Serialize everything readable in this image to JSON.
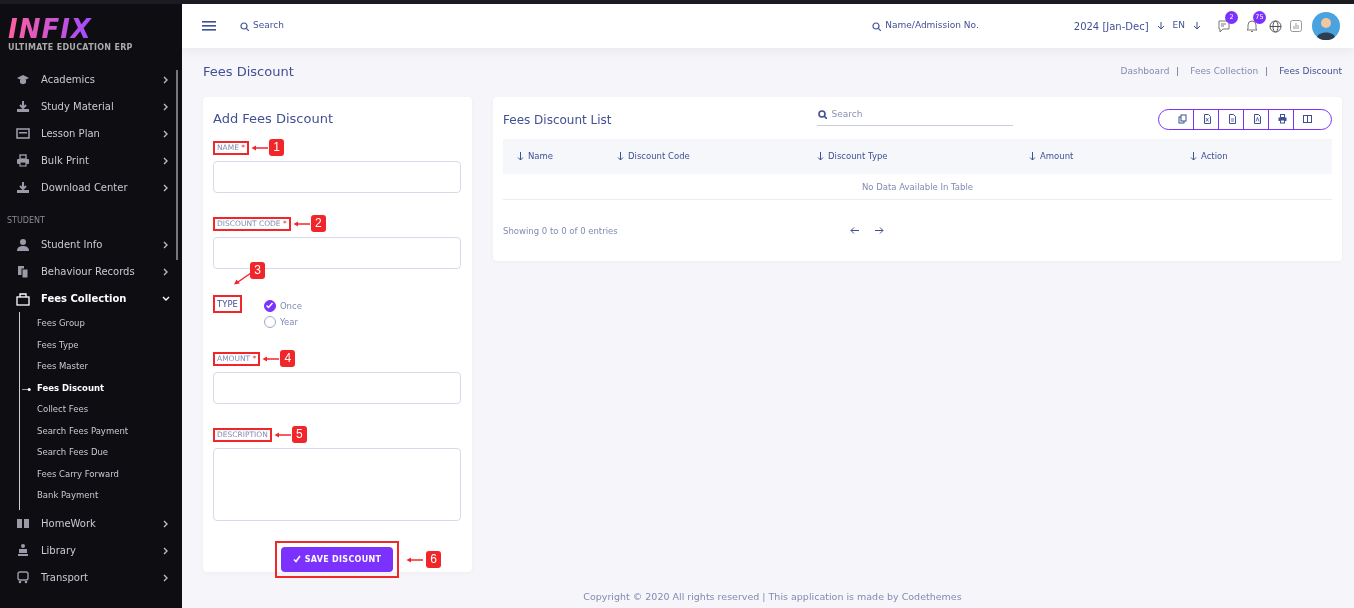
{
  "sidebar": {
    "logo": {
      "title": "INFIX",
      "subtitle": "ULTIMATE EDUCATION ERP"
    },
    "items": [
      {
        "kind": "item",
        "label": "Academics",
        "expanded": false
      },
      {
        "kind": "item",
        "label": "Study Material",
        "expanded": false
      },
      {
        "kind": "item",
        "label": "Lesson Plan",
        "expanded": false
      },
      {
        "kind": "item",
        "label": "Bulk Print",
        "expanded": false
      },
      {
        "kind": "item",
        "label": "Download Center",
        "expanded": false
      },
      {
        "kind": "heading",
        "label": "STUDENT"
      },
      {
        "kind": "item",
        "label": "Student Info",
        "expanded": false
      },
      {
        "kind": "item",
        "label": "Behaviour Records",
        "expanded": false
      },
      {
        "kind": "item",
        "label": "Fees Collection",
        "expanded": true,
        "children": [
          {
            "label": "Fees Group",
            "selected": false
          },
          {
            "label": "Fees Type",
            "selected": false
          },
          {
            "label": "Fees Master",
            "selected": false
          },
          {
            "label": "Fees Discount",
            "selected": true
          },
          {
            "label": "Collect Fees",
            "selected": false
          },
          {
            "label": "Search Fees Payment",
            "selected": false
          },
          {
            "label": "Search Fees Due",
            "selected": false
          },
          {
            "label": "Fees Carry Forward",
            "selected": false
          },
          {
            "label": "Bank Payment",
            "selected": false
          }
        ]
      },
      {
        "kind": "item",
        "label": "HomeWork",
        "expanded": false
      },
      {
        "kind": "item",
        "label": "Library",
        "expanded": false
      },
      {
        "kind": "item",
        "label": "Transport",
        "expanded": false
      }
    ]
  },
  "topbar": {
    "search": {
      "placeholder": "Search"
    },
    "student_search": {
      "placeholder": "Name/Admission No."
    },
    "session": "2024 [Jan-Dec]",
    "language": "EN",
    "messages_badge": "2",
    "notifications_badge": "75"
  },
  "page": {
    "title": "Fees Discount",
    "breadcrumb": [
      {
        "label": "Dashboard",
        "selected": false
      },
      {
        "label": "Fees Collection",
        "selected": false
      },
      {
        "label": "Fees Discount",
        "selected": true
      }
    ]
  },
  "form": {
    "title": "Add Fees Discount",
    "fields": [
      {
        "kind": "input",
        "label": "NAME",
        "required_mark": "*",
        "callout": "1"
      },
      {
        "kind": "input",
        "label": "DISCOUNT CODE",
        "required_mark": "*",
        "callout": "2"
      },
      {
        "kind": "radio",
        "label": "TYPE",
        "callout": "3",
        "options": [
          {
            "label": "Once",
            "selected": true
          },
          {
            "label": "Year",
            "selected": false
          }
        ]
      },
      {
        "kind": "input",
        "label": "AMOUNT",
        "required_mark": "*",
        "callout": "4"
      },
      {
        "kind": "textarea",
        "label": "DESCRIPTION",
        "callout": "5"
      }
    ],
    "submit": {
      "label": "SAVE DISCOUNT",
      "callout": "6"
    }
  },
  "list": {
    "title": "Fees Discount List",
    "search": {
      "placeholder": "Search"
    },
    "columns": [
      "Name",
      "Discount Code",
      "Discount Type",
      "Amount",
      "Action"
    ],
    "empty_message": "No Data Available In Table",
    "info": "Showing 0 to 0 of 0 entries"
  },
  "footer": "Copyright © 2020 All rights reserved | This application is made by Codethemes"
}
